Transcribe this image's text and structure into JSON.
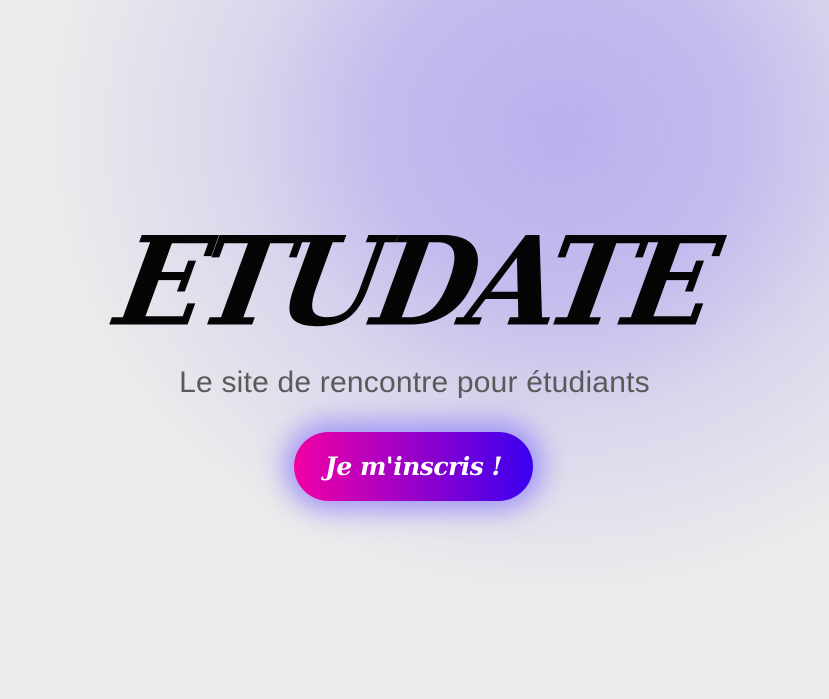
{
  "hero": {
    "title": "ETUDATE",
    "tagline": "Le site de rencontre pour étudiants",
    "cta_label": "Je m'inscris !"
  },
  "colors": {
    "background": "#ececec",
    "glow": "#b5acee",
    "title": "#050505",
    "tagline": "#5a5a5a",
    "button_gradient_start": "#f200a4",
    "button_gradient_end": "#3a00f0",
    "button_text": "#ffffff"
  }
}
